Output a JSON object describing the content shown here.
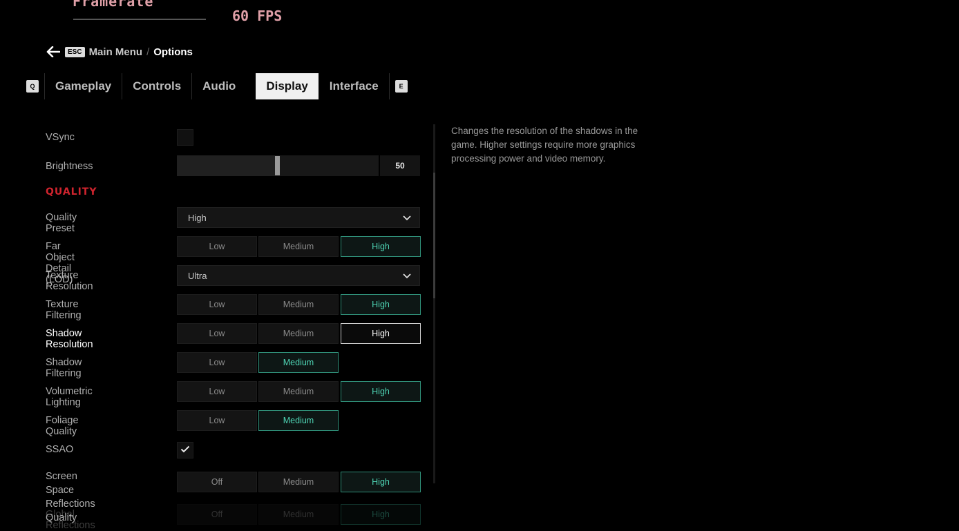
{
  "overlay": {
    "framerate_label": "Framerate",
    "framerate_value": "60 FPS"
  },
  "breadcrumb": {
    "esc_key": "ESC",
    "parent": "Main Menu",
    "separator": "/",
    "current": "Options"
  },
  "tabs": {
    "prev_key": "Q",
    "next_key": "E",
    "items": [
      "Gameplay",
      "Controls",
      "Audio",
      "Display",
      "Interface"
    ],
    "active": "Display"
  },
  "settings": {
    "vsync": {
      "label": "VSync",
      "checked": false
    },
    "brightness": {
      "label": "Brightness",
      "value": "50",
      "fraction": 0.5
    },
    "section_quality": "QUALITY",
    "quality_preset": {
      "label": "Quality Preset",
      "value": "High"
    },
    "far_object_detail": {
      "label": "Far Object Detail (LOD)",
      "options": [
        "Low",
        "Medium",
        "High"
      ],
      "selected": "High"
    },
    "texture_resolution": {
      "label": "Texture Resolution",
      "value": "Ultra"
    },
    "texture_filtering": {
      "label": "Texture Filtering",
      "options": [
        "Low",
        "Medium",
        "High"
      ],
      "selected": "High"
    },
    "shadow_resolution": {
      "label": "Shadow Resolution",
      "options": [
        "Low",
        "Medium",
        "High"
      ],
      "selected": "High"
    },
    "shadow_filtering": {
      "label": "Shadow Filtering",
      "options": [
        "Low",
        "Medium"
      ],
      "selected": "Medium"
    },
    "volumetric_lighting": {
      "label": "Volumetric Lighting",
      "options": [
        "Low",
        "Medium",
        "High"
      ],
      "selected": "High"
    },
    "foliage_quality": {
      "label": "Foliage Quality",
      "options": [
        "Low",
        "Medium"
      ],
      "selected": "Medium"
    },
    "ssao": {
      "label": "SSAO",
      "checked": true
    },
    "ssr_quality": {
      "label_line1": "Screen Space Reflections",
      "label_line2": "Quality",
      "options": [
        "Off",
        "Medium",
        "High"
      ],
      "selected": "High"
    },
    "global_reflections": {
      "label": "Global Reflections",
      "options": [
        "Off",
        "Medium",
        "High"
      ],
      "selected": "High"
    }
  },
  "description": "Changes the resolution of the shadows in the game. Higher settings require more graphics processing power and video memory.",
  "colors": {
    "accent_teal": "#4fd6b6",
    "section_red": "#d0242e",
    "fps_pink": "#e0a0a8"
  }
}
